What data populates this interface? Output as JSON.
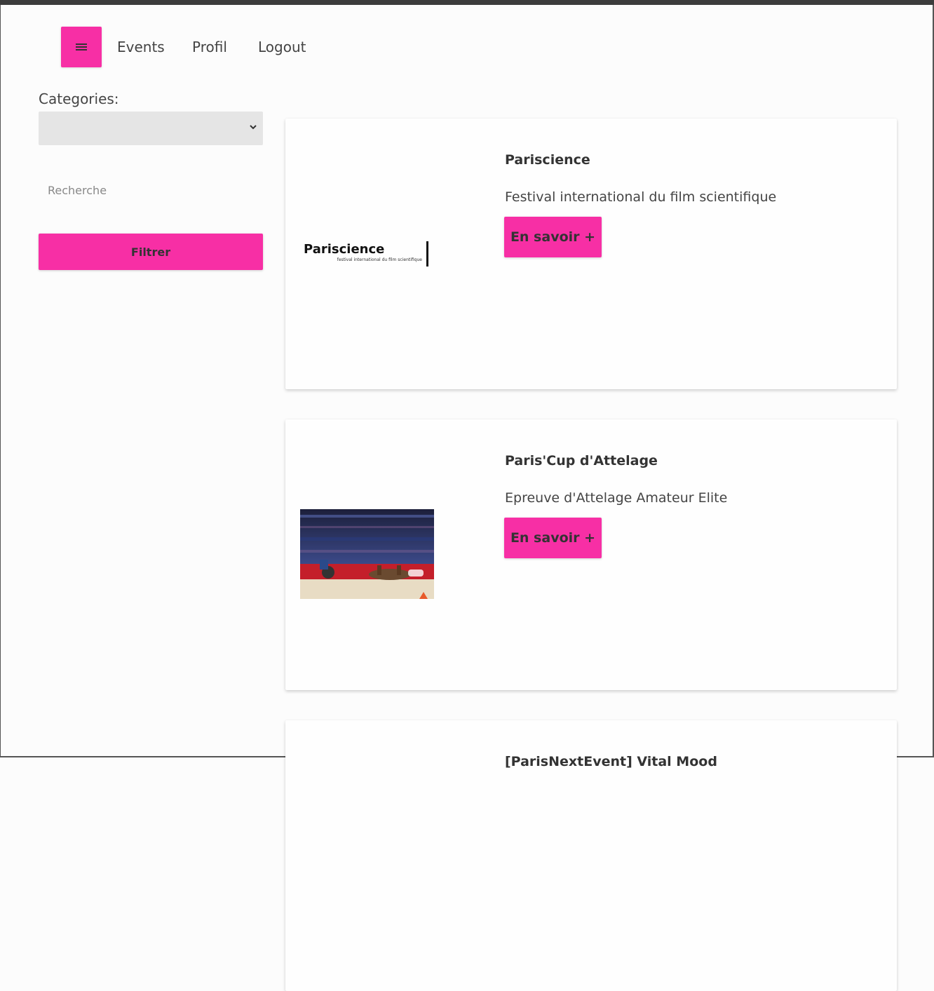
{
  "nav": {
    "menu_icon": "hamburger-menu-icon",
    "links": [
      "Events",
      "Profil",
      "Logout"
    ]
  },
  "sidebar": {
    "categories_label": "Categories:",
    "categories_selected": "",
    "search_placeholder": "Recherche",
    "filter_label": "Filtrer"
  },
  "events": [
    {
      "title": "Pariscience",
      "description": "Festival international du film scientifique",
      "button_label": "En savoir +",
      "image_text": "Pariscience",
      "image_subtext": "festival international du film scientifique"
    },
    {
      "title": "Paris'Cup d'Attelage",
      "description": "Epreuve d'Attelage Amateur Elite",
      "button_label": "En savoir +",
      "image": "horse-carriage-arena-photo"
    },
    {
      "title": "[ParisNextEvent] Vital Mood"
    }
  ],
  "colors": {
    "accent": "#f72fa5",
    "background": "#fcfcfc",
    "text": "#333333"
  }
}
